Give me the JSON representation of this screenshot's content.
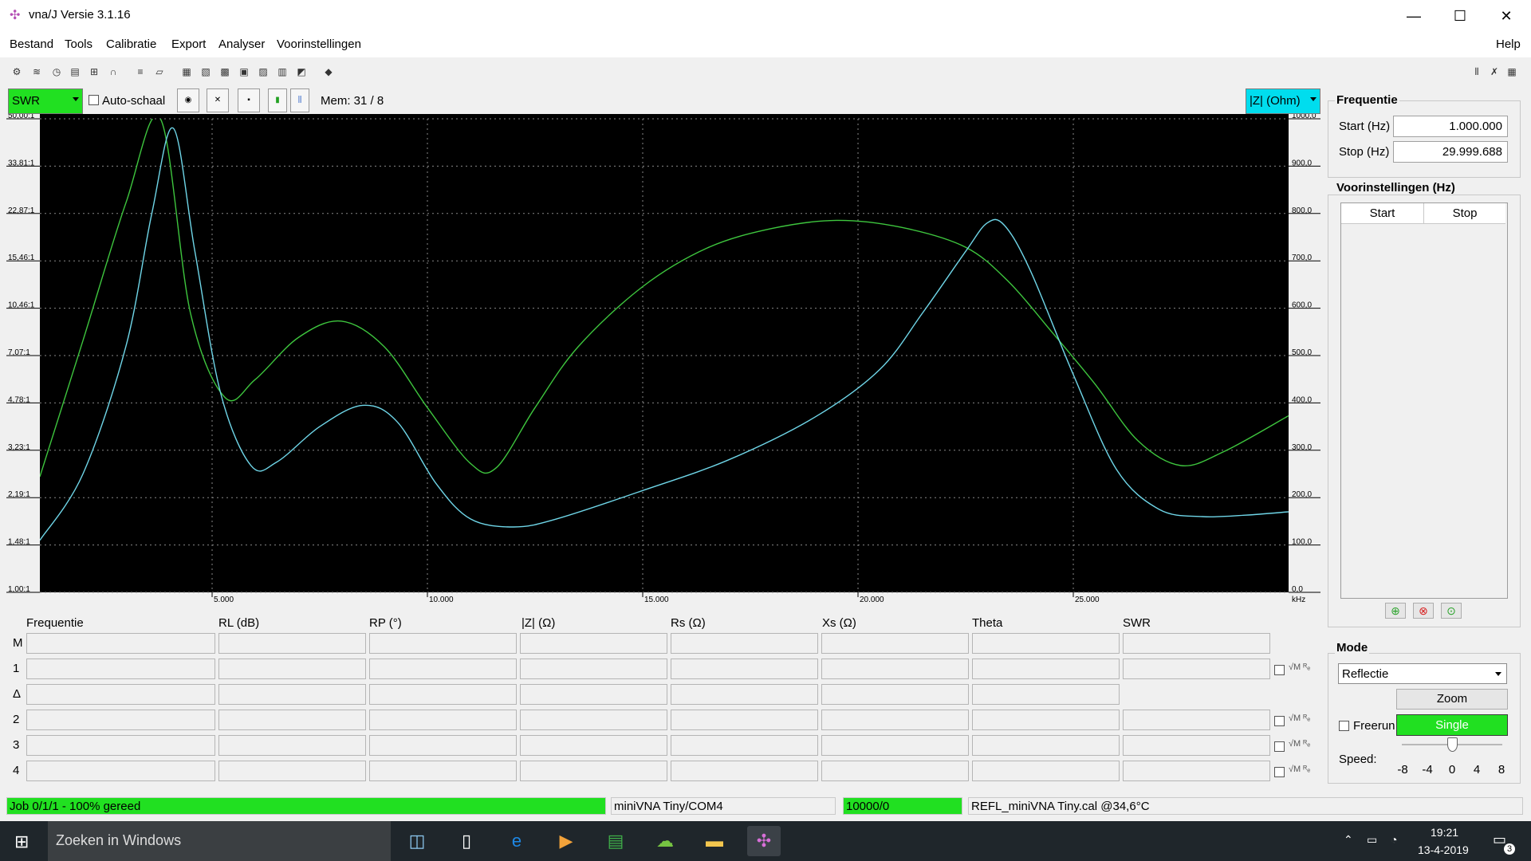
{
  "window": {
    "title": "vna/J Versie 3.1.16",
    "controls": [
      "—",
      "☐",
      "✕"
    ]
  },
  "menu": {
    "items": [
      "Bestand",
      "Tools",
      "Calibratie",
      "Export",
      "Analyser",
      "Voorinstellingen"
    ],
    "help": "Help"
  },
  "chart_controls": {
    "left_select": "SWR",
    "autoscale_label": "Auto-schaal",
    "mem_label": "Mem: 31 / 8",
    "right_select": "|Z| (Ohm)"
  },
  "chart_data": {
    "type": "line",
    "x_unit": "kHz",
    "xlim": [
      1000,
      29999.688
    ],
    "x_ticks": [
      {
        "value": 5000,
        "label": "5.000"
      },
      {
        "value": 10000,
        "label": "10.000"
      },
      {
        "value": 15000,
        "label": "15.000"
      },
      {
        "value": 20000,
        "label": "20.000"
      },
      {
        "value": 25000,
        "label": "25.000"
      }
    ],
    "y_left_ticks": [
      "50,00:1",
      "33,81:1",
      "22,87:1",
      "15,46:1",
      "10,46:1",
      "7,07:1",
      "4,78:1",
      "3,23:1",
      "2,19:1",
      "1,48:1",
      "1,00:1"
    ],
    "y_right_ticks": [
      "1000,0",
      "900,0",
      "800,0",
      "700,0",
      "600,0",
      "500,0",
      "400,0",
      "300,0",
      "200,0",
      "100,0",
      "0,0"
    ],
    "ylim_right": [
      0,
      1000
    ],
    "grid": true,
    "series": [
      {
        "name": "SWR",
        "axis": "left",
        "color": "#3ec63e",
        "points": [
          [
            1000,
            2.6
          ],
          [
            2000,
            8
          ],
          [
            3000,
            25
          ],
          [
            3800,
            50
          ],
          [
            4500,
            10
          ],
          [
            5300,
            5.0
          ],
          [
            6000,
            5.8
          ],
          [
            7000,
            8.2
          ],
          [
            8000,
            9.4
          ],
          [
            9000,
            7.6
          ],
          [
            10000,
            4.6
          ],
          [
            11000,
            2.9
          ],
          [
            11600,
            2.8
          ],
          [
            12500,
            4.6
          ],
          [
            13500,
            7.6
          ],
          [
            15000,
            12.5
          ],
          [
            16500,
            17.2
          ],
          [
            18000,
            20.2
          ],
          [
            19500,
            21.6
          ],
          [
            21000,
            20.4
          ],
          [
            22500,
            17.3
          ],
          [
            23500,
            13
          ],
          [
            24500,
            8.6
          ],
          [
            25500,
            5.6
          ],
          [
            26500,
            3.5
          ],
          [
            27500,
            2.85
          ],
          [
            28500,
            3.2
          ],
          [
            29999,
            4.3
          ]
        ]
      },
      {
        "name": "|Z| (Ohm)",
        "axis": "right",
        "color": "#6fd6e8",
        "points": [
          [
            1000,
            110
          ],
          [
            2000,
            250
          ],
          [
            3000,
            520
          ],
          [
            3600,
            800
          ],
          [
            4100,
            980
          ],
          [
            4600,
            720
          ],
          [
            5200,
            420
          ],
          [
            5900,
            268
          ],
          [
            6500,
            275
          ],
          [
            7500,
            350
          ],
          [
            8500,
            395
          ],
          [
            9300,
            360
          ],
          [
            10200,
            230
          ],
          [
            11000,
            155
          ],
          [
            12000,
            138
          ],
          [
            13000,
            155
          ],
          [
            15000,
            215
          ],
          [
            17000,
            280
          ],
          [
            19000,
            370
          ],
          [
            20500,
            470
          ],
          [
            21500,
            590
          ],
          [
            22500,
            720
          ],
          [
            23000,
            780
          ],
          [
            23400,
            775
          ],
          [
            24000,
            680
          ],
          [
            25000,
            460
          ],
          [
            26000,
            260
          ],
          [
            27000,
            175
          ],
          [
            28000,
            160
          ],
          [
            29000,
            163
          ],
          [
            29999,
            170
          ]
        ]
      }
    ]
  },
  "table": {
    "headers": [
      "Frequentie",
      "RL (dB)",
      "RP (°)",
      "|Z| (Ω)",
      "Rs (Ω)",
      "Xs (Ω)",
      "Theta",
      "SWR"
    ],
    "rows": [
      "M",
      "1",
      "Δ",
      "2",
      "3",
      "4"
    ],
    "row_suffix": "√M ᴿₑ"
  },
  "frequentie": {
    "title": "Frequentie",
    "start_label": "Start (Hz)",
    "start_value": "1.000.000",
    "stop_label": "Stop (Hz)",
    "stop_value": "29.999.688"
  },
  "presets": {
    "title": "Voorinstellingen (Hz)",
    "col_start": "Start",
    "col_stop": "Stop"
  },
  "mode": {
    "title": "Mode",
    "select": "Reflectie",
    "zoom": "Zoom",
    "freerun": "Freerun",
    "single": "Single",
    "speed_label": "Speed:",
    "speed_ticks": [
      "-8",
      "-4",
      "0",
      "4",
      "8"
    ],
    "speed_value": 0
  },
  "status": {
    "job": "Job 0/1/1 - 100% gereed",
    "device": "miniVNA Tiny/COM4",
    "count": "10000/0",
    "cal": "REFL_miniVNA Tiny.cal @34,6°C"
  },
  "taskbar": {
    "search": "Zoeken in Windows",
    "time": "19:21",
    "date": "13-4-2019",
    "notifications": "3"
  },
  "colors": {
    "accent_green": "#21e021",
    "accent_cyan": "#00ddee"
  }
}
